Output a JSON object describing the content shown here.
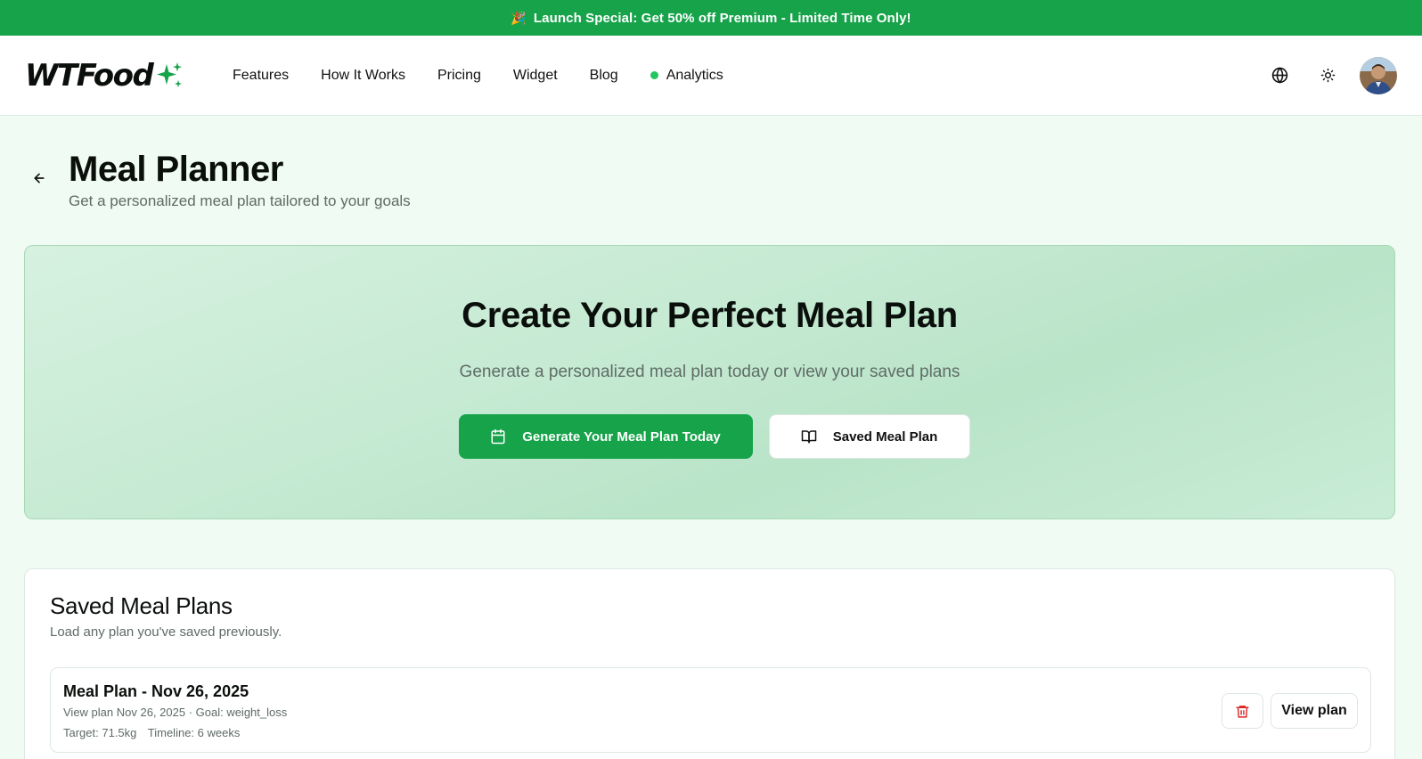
{
  "promo": {
    "emoji": "🎉",
    "text": "Launch Special: Get 50% off Premium - Limited Time Only!"
  },
  "brand": {
    "name": "WTFood",
    "accent": "#16a34a"
  },
  "nav": {
    "links": [
      {
        "label": "Features"
      },
      {
        "label": "How It Works"
      },
      {
        "label": "Pricing"
      },
      {
        "label": "Widget"
      },
      {
        "label": "Blog"
      },
      {
        "label": "Analytics",
        "status_dot_color": "#22c55e"
      }
    ],
    "icons": [
      "globe-icon",
      "sun-icon",
      "avatar"
    ]
  },
  "page": {
    "title": "Meal Planner",
    "subtitle": "Get a personalized meal plan tailored to your goals"
  },
  "hero": {
    "heading": "Create Your Perfect Meal Plan",
    "text": "Generate a personalized meal plan today or view your saved plans",
    "primary_button": "Generate Your Meal Plan Today",
    "secondary_button": "Saved Meal Plan"
  },
  "saved": {
    "heading": "Saved Meal Plans",
    "description": "Load any plan you've saved previously.",
    "plans": [
      {
        "title": "Meal Plan - Nov 26, 2025",
        "meta": "View plan Nov 26, 2025 · Goal: weight_loss",
        "target": "Target: 71.5kg",
        "timeline": "Timeline: 6 weeks",
        "view_label": "View plan"
      }
    ]
  }
}
